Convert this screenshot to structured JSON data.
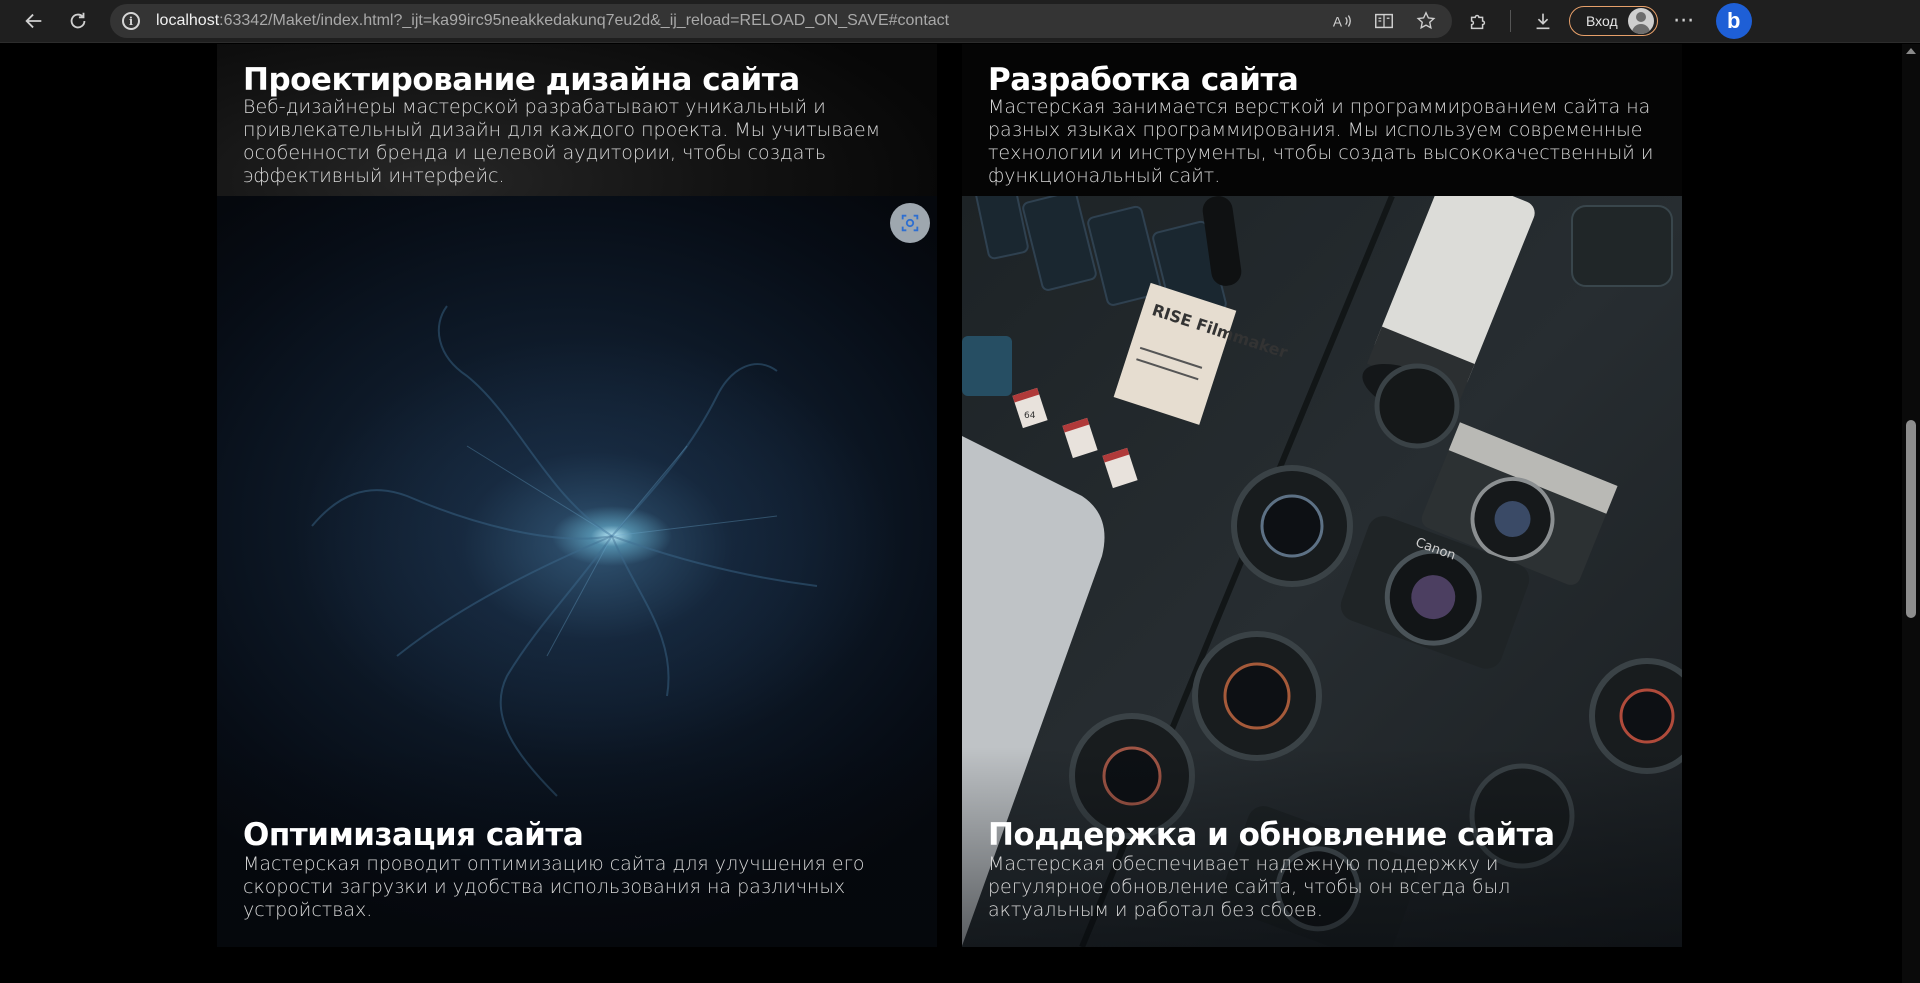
{
  "browser": {
    "url_host": "localhost",
    "url_rest": ":63342/Maket/index.html?_ijt=ka99irc95neakkedakunq7eu2d&_ij_reload=RELOAD_ON_SAVE#contact",
    "login_label": "Вход",
    "more_label": "···",
    "bing_label": "b"
  },
  "cards": [
    {
      "title": "Проектирование дизайна сайта",
      "description": "Веб-дизайнеры мастерской разрабатывают уникальный и привлекательный дизайн для каждого проекта. Мы учитываем особенности бренда и целевой аудитории, чтобы создать эффективный интерфейс."
    },
    {
      "title": "Разработка сайта",
      "description": "Мастерская занимается версткой и программированием сайта на разных языках программирования. Мы используем современные технологии и инструменты, чтобы создать высококачественный и функциональный сайт."
    },
    {
      "title": "Оптимизация сайта",
      "description": "Мастерская проводит оптимизацию сайта для улучшения его скорости загрузки и удобства использования на различных устройствах."
    },
    {
      "title": "Поддержка и обновление сайта",
      "description": "Мастерская обеспечивает надежную поддержку и регулярное обновление сайта, чтобы он всегда был актуальным и работал без сбоев."
    }
  ],
  "photo_labels": {
    "notebook": "RISE Filmmaker",
    "sd_card": "64",
    "brand": "Canon"
  },
  "colors": {
    "accent_login_border": "#e7a06a",
    "bing_blue": "#1e5fd6",
    "page_background": "#000000"
  }
}
